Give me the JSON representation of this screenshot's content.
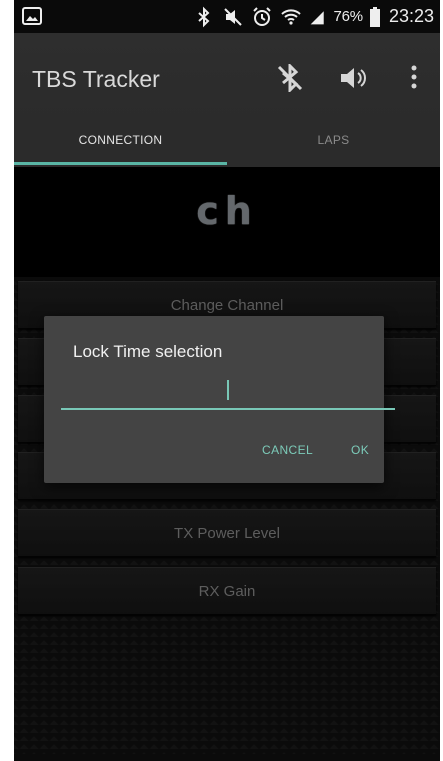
{
  "status_bar": {
    "battery_percent": "76%",
    "time": "23:23",
    "icons": [
      "image-notification-icon",
      "bluetooth-icon",
      "mute-icon",
      "alarm-icon",
      "wifi-icon",
      "signal-icon",
      "battery-icon"
    ]
  },
  "app_bar": {
    "title": "TBS Tracker",
    "actions": [
      "bluetooth-disabled-icon",
      "volume-icon",
      "overflow-menu-icon"
    ]
  },
  "tabs": [
    {
      "label": "CONNECTION",
      "active": true
    },
    {
      "label": "LAPS",
      "active": false
    }
  ],
  "channel_display": "ch",
  "menu_buttons": [
    "Change Channel",
    "TX Power Level",
    "RX Gain"
  ],
  "dialog": {
    "title": "Lock Time selection",
    "input_value": "",
    "cancel_label": "CANCEL",
    "ok_label": "OK"
  },
  "colors": {
    "accent": "#5ab5a5",
    "dialog_bg": "#444444",
    "app_bar_bg": "#2b2b2b"
  }
}
